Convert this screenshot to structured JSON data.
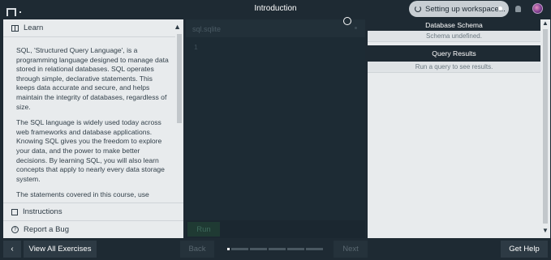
{
  "header": {
    "title": "Introduction",
    "workspace_status": "Setting up workspace...",
    "menu_icon": "menu-icon",
    "bell_icon": "bell-icon"
  },
  "learn": {
    "title": "Learn",
    "paragraphs": [
      "SQL, 'Structured Query Language', is a programming language designed to manage data stored in relational databases. SQL operates through simple, declarative statements. This keeps data accurate and secure, and helps maintain the integrity of databases, regardless of size.",
      "The SQL language is widely used today across web frameworks and database applications. Knowing SQL gives you the freedom to explore your data, and the power to make better decisions. By learning SQL, you will also learn concepts that apply to nearly every data storage system.",
      "The statements covered in this course, use"
    ],
    "instructions_label": "Instructions",
    "report_bug_label": "Report a Bug"
  },
  "editor": {
    "tab_label": "sql.sqlite",
    "line_number": "1",
    "run_label": "Run"
  },
  "database_schema": {
    "title": "Database Schema",
    "status": "Schema undefined."
  },
  "query_results": {
    "title": "Query Results",
    "status": "Run a query to see results."
  },
  "footer": {
    "prev_symbol": "‹",
    "view_all_label": "View All Exercises",
    "back_label": "Back",
    "next_label": "Next",
    "help_label": "Get Help"
  },
  "colors": {
    "background": "#1e2a33",
    "panel": "#e8ebed",
    "editor": "#1d2b34"
  }
}
